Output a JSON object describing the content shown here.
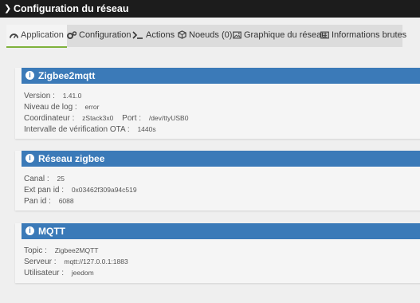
{
  "header": {
    "title": "Configuration du réseau"
  },
  "tabs": [
    {
      "label": "Application",
      "icon": "dashboard-icon"
    },
    {
      "label": "Configuration",
      "icon": "cogs-icon"
    },
    {
      "label": "Actions",
      "icon": "terminal-icon"
    },
    {
      "label": "Noeuds (0)",
      "icon": "cube-icon"
    },
    {
      "label": "Graphique du réseau",
      "icon": "image-icon"
    },
    {
      "label": "Informations brutes",
      "icon": "list-icon"
    }
  ],
  "app": {
    "title": "Zigbee2mqtt",
    "version_label": "Version :",
    "version": "1.41.0",
    "loglevel_label": "Niveau de log :",
    "loglevel": "error",
    "coordinator_label": "Coordinateur :",
    "coordinator": "zStack3x0",
    "port_label": "Port :",
    "port": "/dev/ttyUSB0",
    "ota_label": "Intervalle de vérification OTA :",
    "ota": "1440s"
  },
  "zigbee": {
    "title": "Réseau zigbee",
    "channel_label": "Canal :",
    "channel": "25",
    "ext_pan_label": "Ext pan id :",
    "ext_pan": "0x03462f309a94c519",
    "pan_label": "Pan id :",
    "pan": "6088"
  },
  "mqtt": {
    "title": "MQTT",
    "topic_label": "Topic :",
    "topic": "Zigbee2MQTT",
    "server_label": "Serveur :",
    "server": "mqtt://127.0.0.1:1883",
    "user_label": "Utilisateur :",
    "user": "jeedom"
  },
  "colors": {
    "header_bg": "#1c1c1c",
    "panel_header": "#3b7ab8",
    "tab_active_border": "#7fb23c"
  }
}
